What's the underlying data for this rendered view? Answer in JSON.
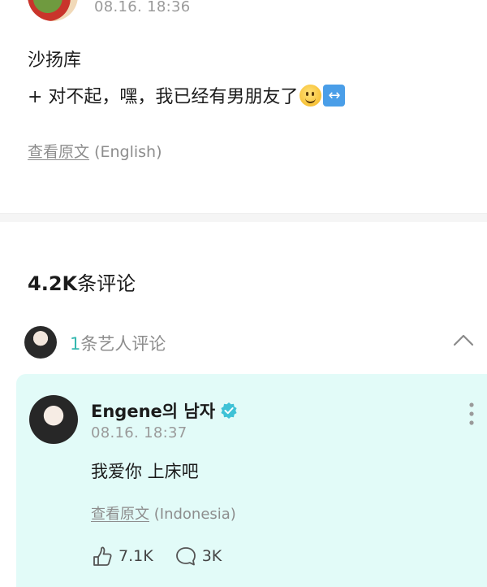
{
  "post": {
    "time": "08.16. 18:36",
    "line1": "沙扬库",
    "line2": "+ 对不起，嘿，我已经有男朋友了",
    "emoji1": "smile-emoji-icon",
    "emoji2": "left-right-arrow-emoji-icon",
    "translate_link": "查看原文",
    "translate_lang": "(English)"
  },
  "comments": {
    "count_number": "4.2K",
    "count_label": "条评论",
    "artist_count": "1",
    "artist_label": "条艺人评论"
  },
  "artist_comment": {
    "username": "Engene의 남자",
    "time": "08.16. 18:37",
    "text": "我爱你 上床吧",
    "translate_link": "查看原文",
    "translate_lang": "(Indonesia)",
    "likes": "7.1K",
    "replies": "3K"
  },
  "colors": {
    "accent": "#36b8b0",
    "card_bg": "#e2fbf8",
    "verified": "#3ec2d6"
  }
}
